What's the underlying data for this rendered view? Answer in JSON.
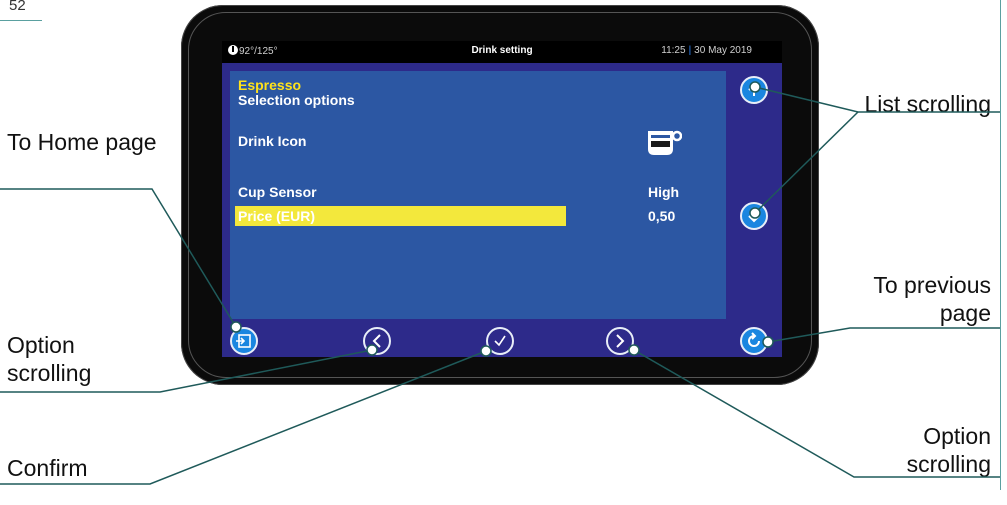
{
  "page_number": "52",
  "screen": {
    "status": {
      "temperature": "92°/125°",
      "title": "Drink setting",
      "time": "11:25",
      "date": "30 May 2019"
    },
    "drink_name": "Espresso",
    "section": "Selection options",
    "rows": [
      {
        "label": "Drink Icon",
        "value": ""
      },
      {
        "label": "Cup Sensor",
        "value": "High"
      },
      {
        "label": "Price (EUR)",
        "value": "0,50",
        "selected": true
      }
    ],
    "icons": {
      "drink": "espresso-cup-icon",
      "home": "home-exit-icon",
      "option_prev": "chevron-left-icon",
      "confirm": "checkmark-icon",
      "option_next": "chevron-right-icon",
      "list_up": "arrow-up-icon",
      "list_down": "arrow-down-icon",
      "previous_page": "back-icon"
    },
    "colors": {
      "accent_highlight": "#f3e83c",
      "title_yellow": "#ffe21a",
      "button_blue": "#1a86e0",
      "screen_blue": "#2c57a3",
      "frame_purple": "#2d2a8a"
    }
  },
  "callouts": {
    "home": "To Home page",
    "list_scrolling": "List scrolling",
    "previous_page": "To previous page",
    "option_scrolling_left": "Option scrolling",
    "confirm": "Confirm",
    "option_scrolling_right": "Option scrolling"
  }
}
